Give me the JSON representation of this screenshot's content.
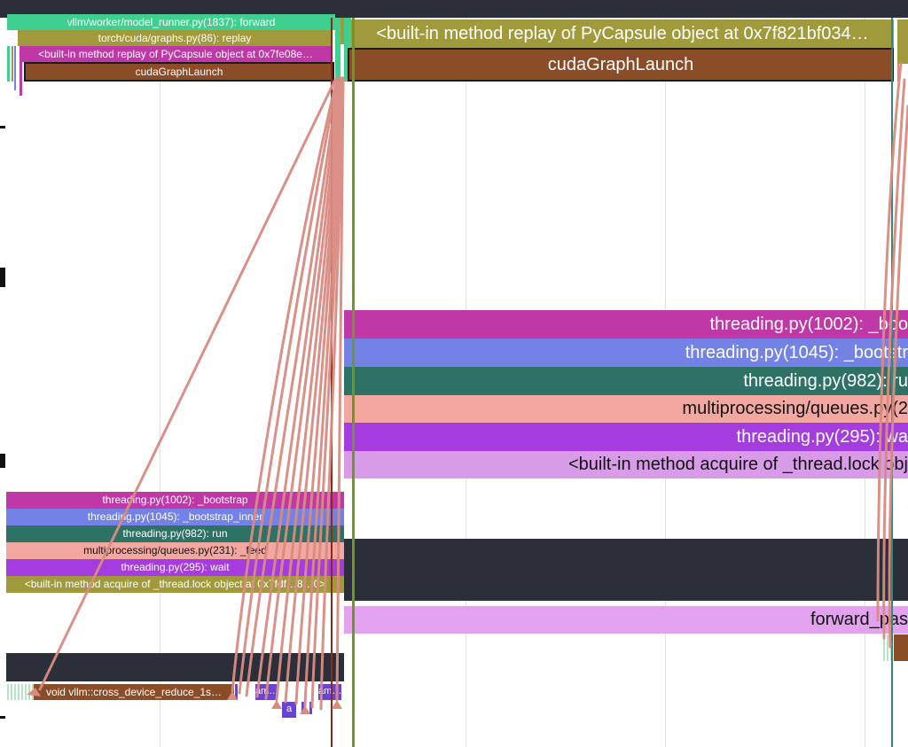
{
  "colors": {
    "toolbar": "#2b2f3a",
    "green": "#3fcf8e",
    "olive": "#a09a3c",
    "magenta": "#c038a8",
    "brown": "#8b4c28",
    "periwinkle": "#7482e6",
    "teal": "#2e7266",
    "salmon": "#f2a8a0",
    "purple": "#a43ce0",
    "lilac": "#d89be8",
    "pink_lilac": "#e3a2ee",
    "arrow": "#d98b80"
  },
  "left_panel": {
    "top_stack": {
      "model_runner": "vllm/worker/model_runner.py(1837): forward",
      "graphs_replay": "torch/cuda/graphs.py(86): replay",
      "builtin_replay": "<built-in method replay of PyCapsule object at 0x7fe08e…",
      "cuda_graph_launch": "cudaGraphLaunch"
    },
    "thread_stack": {
      "bootstrap": "threading.py(1002): _bootstrap",
      "bootstrap_inner": "threading.py(1045): _bootstrap_inner",
      "run": "threading.py(982): run",
      "queues_feed": "multiprocessing/queues.py(231): _feed",
      "wait": "threading.py(295): wait",
      "acquire": "<built-in method acquire of _thread.lock object at 0x7fdf…8…0>"
    },
    "gpu_kernels": {
      "cross_device_reduce": "void vllm::cross_device_reduce_1s…",
      "k1": "am…",
      "k2": "a",
      "k3": "am…"
    }
  },
  "right_panel": {
    "top_stack": {
      "builtin_replay": "<built-in method replay of PyCapsule object at 0x7f821bf034…",
      "cuda_graph_launch": "cudaGraphLaunch"
    },
    "thread_stack": {
      "bootstrap": "threading.py(1002): _boo",
      "bootstrap_inner": "threading.py(1045): _bootstr",
      "run": "threading.py(982): ru",
      "queues_feed": "multiprocessing/queues.py(2",
      "wait": "threading.py(295): wa",
      "acquire": "<built-in method acquire of _thread.lock obj"
    },
    "forward_pass": "forward_pas"
  }
}
